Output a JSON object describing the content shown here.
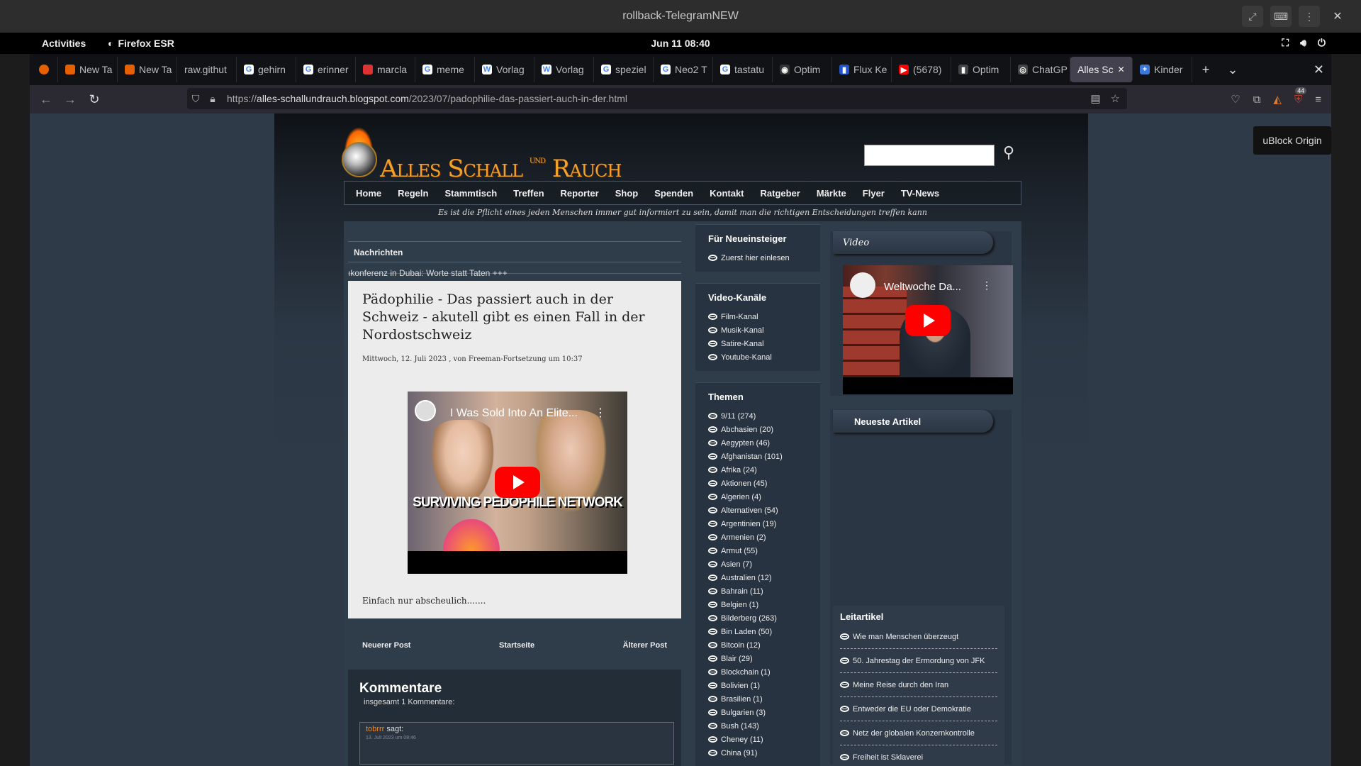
{
  "window": {
    "title": "rollback-TelegramNEW"
  },
  "gnome": {
    "activities": "Activities",
    "app": "Firefox ESR",
    "clock": "Jun 11  08:40"
  },
  "tabs": [
    {
      "label": "New Ta",
      "fav": "firefox"
    },
    {
      "label": "New Ta",
      "fav": "firefox"
    },
    {
      "label": "raw.githut",
      "fav": "none"
    },
    {
      "label": "gehirn",
      "fav": "google"
    },
    {
      "label": "erinner",
      "fav": "google"
    },
    {
      "label": "marcla",
      "fav": "red"
    },
    {
      "label": "meme",
      "fav": "google"
    },
    {
      "label": "Vorlag",
      "fav": "wiki"
    },
    {
      "label": "Vorlag",
      "fav": "wiki"
    },
    {
      "label": "speziel",
      "fav": "google"
    },
    {
      "label": "Neo2 T",
      "fav": "google"
    },
    {
      "label": "tastatu",
      "fav": "google"
    },
    {
      "label": "Optim",
      "fav": "eye"
    },
    {
      "label": "Flux Ke",
      "fav": "flux"
    },
    {
      "label": "(5678)",
      "fav": "youtube"
    },
    {
      "label": "Optim",
      "fav": "bars"
    },
    {
      "label": "ChatGP",
      "fav": "chatgpt"
    },
    {
      "label": "Alles Sc",
      "fav": "none",
      "active": true
    },
    {
      "label": "Kinder",
      "fav": "plus"
    }
  ],
  "url": {
    "prefix": "https://",
    "host": "alles-schallundrauch.blogspot.com",
    "path": "/2023/07/padophilie-das-passiert-auch-in-der.html"
  },
  "ublock": {
    "count": "44",
    "tooltip": "uBlock Origin"
  },
  "site": {
    "logo": {
      "part1": "Alles Schall",
      "und": "und",
      "part2": "Rauch"
    },
    "menu": [
      "Home",
      "Regeln",
      "Stammtisch",
      "Treffen",
      "Reporter",
      "Shop",
      "Spenden",
      "Kontakt",
      "Ratgeber",
      "Märkte",
      "Flyer",
      "TV-News"
    ],
    "motto": "Es ist die Pflicht eines jeden Menschen immer gut informiert zu sein, damit man die richtigen Entscheidungen treffen kann",
    "news": {
      "heading": "Nachrichten",
      "ticker": "ıkonferenz in Dubai: Worte statt Taten +++"
    },
    "post": {
      "title": "Pädophilie - Das passiert auch in der Schweiz - akutell gibt es einen Fall in der Nordostschweiz",
      "meta": "Mittwoch, 12. Juli 2023 , von Freeman-Fortsetzung um 10:37",
      "video_title": "I Was Sold Into An Elite...",
      "video_banner": "SURVIVING PEDOPHILE NETWORK",
      "body": "Einfach nur abscheulich......."
    },
    "pager": {
      "newer": "Neuerer Post",
      "home": "Startseite",
      "older": "Älterer Post"
    },
    "comments": {
      "heading": "Kommentare",
      "count": "insgesamt 1 Kommentare:",
      "author": "tobrrr",
      "says": "sagt:",
      "date": "13. Juli 2023 um 08:46"
    },
    "beginner": {
      "heading": "Für Neueinsteiger",
      "items": [
        "Zuerst hier einlesen"
      ]
    },
    "channels": {
      "heading": "Video-Kanäle",
      "items": [
        "Film-Kanal",
        "Musik-Kanal",
        "Satire-Kanal",
        "Youtube-Kanal"
      ]
    },
    "topics": {
      "heading": "Themen",
      "items": [
        "9/11 (274)",
        "Abchasien (20)",
        "Aegypten (46)",
        "Afghanistan (101)",
        "Afrika (24)",
        "Aktionen (45)",
        "Algerien (4)",
        "Alternativen (54)",
        "Argentinien (19)",
        "Armenien (2)",
        "Armut (55)",
        "Asien (7)",
        "Australien (12)",
        "Bahrain (11)",
        "Belgien (1)",
        "Bilderberg (263)",
        "Bin Laden (50)",
        "Bitcoin (12)",
        "Blair (29)",
        "Blockchain (1)",
        "Bolivien (1)",
        "Brasilien (1)",
        "Bulgarien (3)",
        "Bush (143)",
        "Cheney (11)",
        "China (91)"
      ]
    },
    "video": {
      "heading": "Video",
      "title": "Weltwoche Da..."
    },
    "latest": {
      "heading": "Neueste Artikel"
    },
    "lead": {
      "heading": "Leitartikel",
      "items": [
        "Wie man Menschen überzeugt",
        "50. Jahrestag der Ermordung von JFK",
        "Meine Reise durch den Iran",
        "Entweder die EU oder Demokratie",
        "Netz der globalen Konzernkontrolle",
        "Freiheit ist Sklaverei"
      ]
    }
  }
}
